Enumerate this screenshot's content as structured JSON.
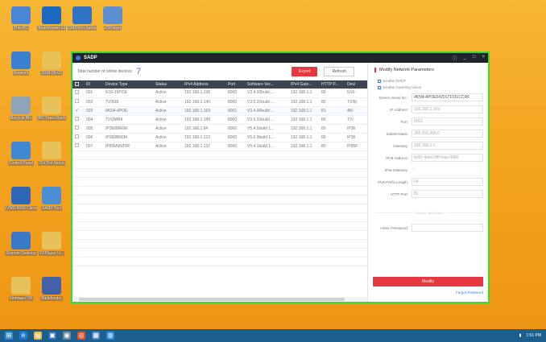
{
  "desktop": {
    "icons": [
      {
        "label": "This PC",
        "color": "#4a86d8"
      },
      {
        "label": "TeamViewer 13",
        "color": "#1d69c2"
      },
      {
        "label": "CMS Pro Setup",
        "color": "#2f73c7"
      },
      {
        "label": "VSPlayer",
        "color": "#5b8fd1"
      },
      {
        "label": "Network",
        "color": "#3b7fd1"
      },
      {
        "label": "2018-06-03",
        "color": "#e7c25a"
      },
      {
        "label": "Recycle Bin",
        "color": "#8fa3b8"
      },
      {
        "label": "IPC Tools Flash",
        "color": "#e7c25a"
      },
      {
        "label": "Control Panel",
        "color": "#3f88d4"
      },
      {
        "label": "Chi Tiet Video",
        "color": "#e7c25a"
      },
      {
        "label": "iVMS-4200 Client",
        "color": "#2f66b8"
      },
      {
        "label": "SADP Tool",
        "color": "#4c8fd6"
      },
      {
        "label": "Remote Desktop",
        "color": "#3a79c8"
      },
      {
        "label": "VSPlayer Ix...",
        "color": "#e7c25a"
      },
      {
        "label": "Firmware V5",
        "color": "#e7c25a"
      },
      {
        "label": "Bitdefender",
        "color": "#4361a8"
      }
    ]
  },
  "sadp": {
    "title": "SADP",
    "window_controls": {
      "info": "ⓘ",
      "minimize": "_",
      "maximize": "□",
      "close": "×"
    },
    "toolbar": {
      "total_label": "Total number of online devices:",
      "total_count": "7",
      "export_label": "Export",
      "refresh_label": "Refresh"
    },
    "table": {
      "columns": [
        "",
        "ID",
        "Device Type",
        "Status",
        "IPv4 Address",
        "Port",
        "Software Ver...",
        "IPv4 Gate...",
        "HTTP P...",
        "Devi"
      ],
      "rows": [
        {
          "id": "001",
          "type": "N16-16POE",
          "status": "Active",
          "ip": "192.168.1.198",
          "port": "8000",
          "ver": "V3.4.92build ...",
          "gw": "192.168.1.1",
          "http": "80",
          "dev": "N16-",
          "checked": false
        },
        {
          "id": "002",
          "type": "TVI508",
          "status": "Active",
          "ip": "192.168.1.140",
          "port": "8000",
          "ver": "V3.5.31build ...",
          "gw": "192.168.1.1",
          "http": "80",
          "dev": "TVI5(",
          "checked": false
        },
        {
          "id": "003",
          "type": "4KN4-4POE",
          "status": "Active",
          "ip": "192.168.1.169",
          "port": "8001",
          "ver": "V3.4.96build ...",
          "gw": "192.168.1.1",
          "http": "81",
          "dev": "4KI",
          "checked": true
        },
        {
          "id": "004",
          "type": "TVI2MR4",
          "status": "Active",
          "ip": "192.168.1.189",
          "port": "8000",
          "ver": "V3.5.31build ...",
          "gw": "192.168.1.1",
          "http": "80",
          "dev": "TVI",
          "checked": false
        },
        {
          "id": "005",
          "type": "IP360BR6M",
          "status": "Active",
          "ip": "192.168.1.64",
          "port": "8000",
          "ver": "V5.4.5build 1...",
          "gw": "192.168.1.1",
          "http": "80",
          "dev": "IP36",
          "checked": false
        },
        {
          "id": "006",
          "type": "IP360BR6M",
          "status": "Active",
          "ip": "192.168.1.123",
          "port": "8000",
          "ver": "V5.0.9build 1...",
          "gw": "192.168.1.1",
          "http": "80",
          "dev": "IP36",
          "checked": false
        },
        {
          "id": "007",
          "type": "IP85MMVFIR",
          "status": "Active",
          "ip": "192.168.1.137",
          "port": "8000",
          "ver": "V5.4.1build 1...",
          "gw": "192.168.1.1",
          "http": "80",
          "dev": "IP85F",
          "checked": false
        }
      ]
    },
    "panel": {
      "title": "Modify Network Parameters",
      "enable_dhcp": "Enable DHCP",
      "enable_guarding": "Enable Guarding Vision",
      "fields": [
        {
          "label": "Device Serial No.:",
          "value": "4KN4-4POE0420171031CCRF"
        },
        {
          "label": "IP Address:",
          "value": "192.168.1.169"
        },
        {
          "label": "Port:",
          "value": "8001"
        },
        {
          "label": "Subnet Mask:",
          "value": "255.255.255.0"
        },
        {
          "label": "Gateway:",
          "value": "192.168.1.1"
        },
        {
          "label": "IPv6 Address:",
          "value": "fe80::4ebd:8fff:feaa:4980"
        },
        {
          "label": "IPv6 Gateway:",
          "value": "::"
        },
        {
          "label": "IPv6 Prefix Length:",
          "value": "64"
        },
        {
          "label": "HTTP Port:",
          "value": "81"
        }
      ],
      "security_label": "Security Verification",
      "admin_password_label": "Admin Password:",
      "modify_label": "Modify",
      "forgot_label": "Forgot Password"
    }
  },
  "taskbar": {
    "time": "1:51 PM",
    "apps": [
      "⊞",
      "e",
      "▤",
      "▣",
      "◉",
      "◎",
      "▦",
      "◍"
    ]
  }
}
